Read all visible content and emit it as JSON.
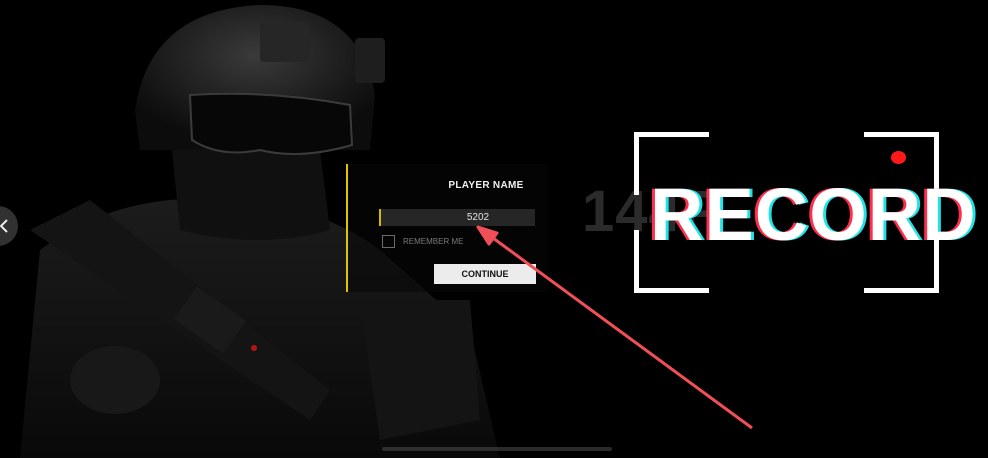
{
  "login": {
    "title": "PLAYER NAME",
    "player_name_value": "5202",
    "remember_label": "REMEMBER ME",
    "remember_checked": false,
    "continue_label": "CONTINUE"
  },
  "logo": {
    "ghost_text": "144P",
    "text": "RECORD"
  },
  "colors": {
    "accent_yellow": "#e3c200",
    "record_dot": "#ff1a1a",
    "annotation_arrow": "#f04f57"
  },
  "icons": {
    "back": "chevron-left-icon",
    "annotation": "arrow-annotation"
  }
}
